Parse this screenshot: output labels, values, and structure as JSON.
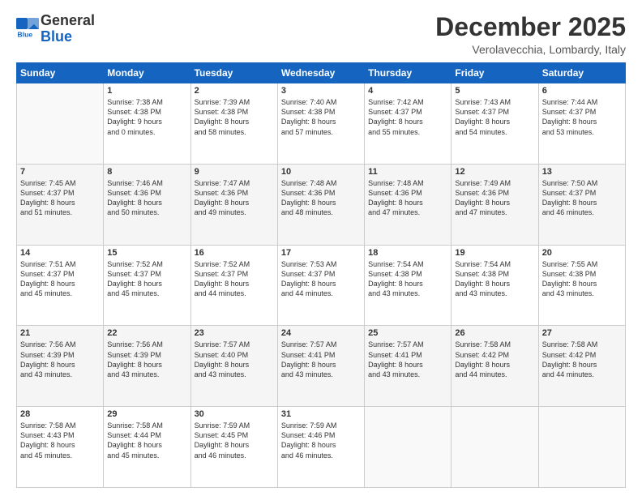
{
  "header": {
    "logo_general": "General",
    "logo_blue": "Blue",
    "month_title": "December 2025",
    "location": "Verolavecchia, Lombardy, Italy"
  },
  "weekdays": [
    "Sunday",
    "Monday",
    "Tuesday",
    "Wednesday",
    "Thursday",
    "Friday",
    "Saturday"
  ],
  "weeks": [
    [
      {
        "day": "",
        "info": ""
      },
      {
        "day": "1",
        "info": "Sunrise: 7:38 AM\nSunset: 4:38 PM\nDaylight: 9 hours\nand 0 minutes."
      },
      {
        "day": "2",
        "info": "Sunrise: 7:39 AM\nSunset: 4:38 PM\nDaylight: 8 hours\nand 58 minutes."
      },
      {
        "day": "3",
        "info": "Sunrise: 7:40 AM\nSunset: 4:38 PM\nDaylight: 8 hours\nand 57 minutes."
      },
      {
        "day": "4",
        "info": "Sunrise: 7:42 AM\nSunset: 4:37 PM\nDaylight: 8 hours\nand 55 minutes."
      },
      {
        "day": "5",
        "info": "Sunrise: 7:43 AM\nSunset: 4:37 PM\nDaylight: 8 hours\nand 54 minutes."
      },
      {
        "day": "6",
        "info": "Sunrise: 7:44 AM\nSunset: 4:37 PM\nDaylight: 8 hours\nand 53 minutes."
      }
    ],
    [
      {
        "day": "7",
        "info": "Sunrise: 7:45 AM\nSunset: 4:37 PM\nDaylight: 8 hours\nand 51 minutes."
      },
      {
        "day": "8",
        "info": "Sunrise: 7:46 AM\nSunset: 4:36 PM\nDaylight: 8 hours\nand 50 minutes."
      },
      {
        "day": "9",
        "info": "Sunrise: 7:47 AM\nSunset: 4:36 PM\nDaylight: 8 hours\nand 49 minutes."
      },
      {
        "day": "10",
        "info": "Sunrise: 7:48 AM\nSunset: 4:36 PM\nDaylight: 8 hours\nand 48 minutes."
      },
      {
        "day": "11",
        "info": "Sunrise: 7:48 AM\nSunset: 4:36 PM\nDaylight: 8 hours\nand 47 minutes."
      },
      {
        "day": "12",
        "info": "Sunrise: 7:49 AM\nSunset: 4:36 PM\nDaylight: 8 hours\nand 47 minutes."
      },
      {
        "day": "13",
        "info": "Sunrise: 7:50 AM\nSunset: 4:37 PM\nDaylight: 8 hours\nand 46 minutes."
      }
    ],
    [
      {
        "day": "14",
        "info": "Sunrise: 7:51 AM\nSunset: 4:37 PM\nDaylight: 8 hours\nand 45 minutes."
      },
      {
        "day": "15",
        "info": "Sunrise: 7:52 AM\nSunset: 4:37 PM\nDaylight: 8 hours\nand 45 minutes."
      },
      {
        "day": "16",
        "info": "Sunrise: 7:52 AM\nSunset: 4:37 PM\nDaylight: 8 hours\nand 44 minutes."
      },
      {
        "day": "17",
        "info": "Sunrise: 7:53 AM\nSunset: 4:37 PM\nDaylight: 8 hours\nand 44 minutes."
      },
      {
        "day": "18",
        "info": "Sunrise: 7:54 AM\nSunset: 4:38 PM\nDaylight: 8 hours\nand 43 minutes."
      },
      {
        "day": "19",
        "info": "Sunrise: 7:54 AM\nSunset: 4:38 PM\nDaylight: 8 hours\nand 43 minutes."
      },
      {
        "day": "20",
        "info": "Sunrise: 7:55 AM\nSunset: 4:38 PM\nDaylight: 8 hours\nand 43 minutes."
      }
    ],
    [
      {
        "day": "21",
        "info": "Sunrise: 7:56 AM\nSunset: 4:39 PM\nDaylight: 8 hours\nand 43 minutes."
      },
      {
        "day": "22",
        "info": "Sunrise: 7:56 AM\nSunset: 4:39 PM\nDaylight: 8 hours\nand 43 minutes."
      },
      {
        "day": "23",
        "info": "Sunrise: 7:57 AM\nSunset: 4:40 PM\nDaylight: 8 hours\nand 43 minutes."
      },
      {
        "day": "24",
        "info": "Sunrise: 7:57 AM\nSunset: 4:41 PM\nDaylight: 8 hours\nand 43 minutes."
      },
      {
        "day": "25",
        "info": "Sunrise: 7:57 AM\nSunset: 4:41 PM\nDaylight: 8 hours\nand 43 minutes."
      },
      {
        "day": "26",
        "info": "Sunrise: 7:58 AM\nSunset: 4:42 PM\nDaylight: 8 hours\nand 44 minutes."
      },
      {
        "day": "27",
        "info": "Sunrise: 7:58 AM\nSunset: 4:42 PM\nDaylight: 8 hours\nand 44 minutes."
      }
    ],
    [
      {
        "day": "28",
        "info": "Sunrise: 7:58 AM\nSunset: 4:43 PM\nDaylight: 8 hours\nand 45 minutes."
      },
      {
        "day": "29",
        "info": "Sunrise: 7:58 AM\nSunset: 4:44 PM\nDaylight: 8 hours\nand 45 minutes."
      },
      {
        "day": "30",
        "info": "Sunrise: 7:59 AM\nSunset: 4:45 PM\nDaylight: 8 hours\nand 46 minutes."
      },
      {
        "day": "31",
        "info": "Sunrise: 7:59 AM\nSunset: 4:46 PM\nDaylight: 8 hours\nand 46 minutes."
      },
      {
        "day": "",
        "info": ""
      },
      {
        "day": "",
        "info": ""
      },
      {
        "day": "",
        "info": ""
      }
    ]
  ]
}
